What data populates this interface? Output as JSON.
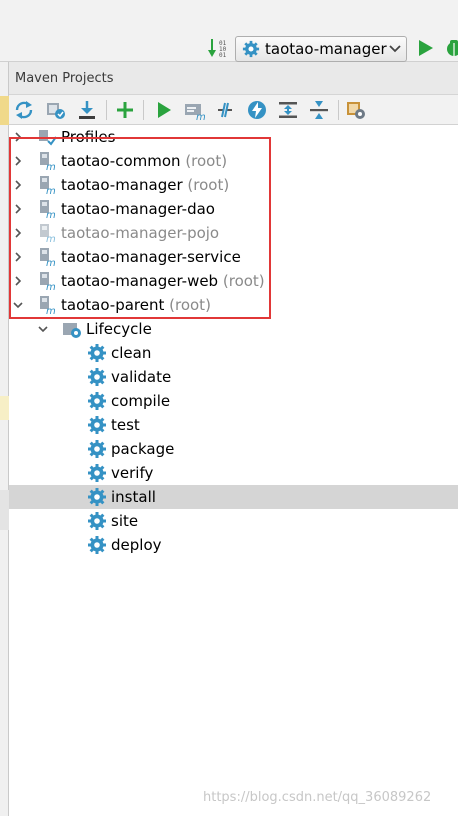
{
  "toolbar": {
    "run_config": "taotao-manager",
    "icons": [
      "sort-icon",
      "gear-icon",
      "chevron-down-icon",
      "run-icon",
      "debug-icon"
    ]
  },
  "panel": {
    "title": "Maven Projects",
    "toolbar_icons": [
      "reimport-icon",
      "generate-sources-icon",
      "download-icon",
      "add-icon",
      "run-build-icon",
      "execute-goal-icon",
      "toggle-offline-icon",
      "skip-tests-icon",
      "show-dependencies-icon",
      "collapse-all-icon",
      "settings-icon"
    ]
  },
  "tree": {
    "profiles": "Profiles",
    "modules": [
      {
        "name": "taotao-common",
        "suffix": "(root)"
      },
      {
        "name": "taotao-manager",
        "suffix": "(root)"
      },
      {
        "name": "taotao-manager-dao",
        "suffix": ""
      },
      {
        "name": "taotao-manager-pojo",
        "suffix": ""
      },
      {
        "name": "taotao-manager-service",
        "suffix": ""
      },
      {
        "name": "taotao-manager-web",
        "suffix": "(root)"
      },
      {
        "name": "taotao-parent",
        "suffix": "(root)"
      }
    ],
    "lifecycle": "Lifecycle",
    "phases": [
      "clean",
      "validate",
      "compile",
      "test",
      "package",
      "verify",
      "install",
      "site",
      "deploy"
    ],
    "selected_phase": "install"
  },
  "watermark": "https://blog.csdn.net/qq_36089262",
  "colors": {
    "accent": "#3592c4",
    "run_green": "#2aa33e",
    "highlight_red": "#e13737"
  }
}
